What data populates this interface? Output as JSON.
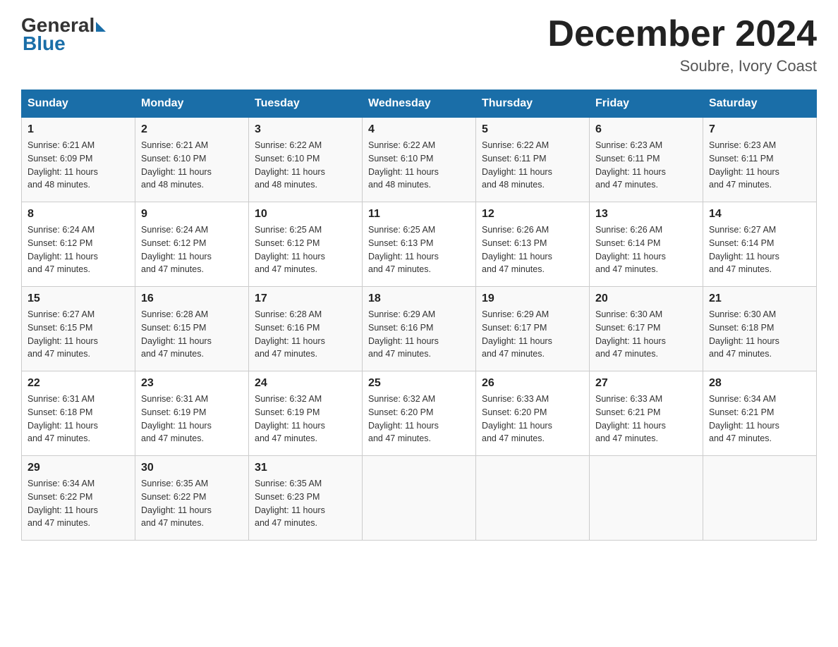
{
  "logo": {
    "general": "General",
    "blue": "Blue"
  },
  "header": {
    "month_year": "December 2024",
    "location": "Soubre, Ivory Coast"
  },
  "days_of_week": [
    "Sunday",
    "Monday",
    "Tuesday",
    "Wednesday",
    "Thursday",
    "Friday",
    "Saturday"
  ],
  "weeks": [
    [
      {
        "day": "1",
        "sunrise": "6:21 AM",
        "sunset": "6:09 PM",
        "daylight": "11 hours and 48 minutes."
      },
      {
        "day": "2",
        "sunrise": "6:21 AM",
        "sunset": "6:10 PM",
        "daylight": "11 hours and 48 minutes."
      },
      {
        "day": "3",
        "sunrise": "6:22 AM",
        "sunset": "6:10 PM",
        "daylight": "11 hours and 48 minutes."
      },
      {
        "day": "4",
        "sunrise": "6:22 AM",
        "sunset": "6:10 PM",
        "daylight": "11 hours and 48 minutes."
      },
      {
        "day": "5",
        "sunrise": "6:22 AM",
        "sunset": "6:11 PM",
        "daylight": "11 hours and 48 minutes."
      },
      {
        "day": "6",
        "sunrise": "6:23 AM",
        "sunset": "6:11 PM",
        "daylight": "11 hours and 47 minutes."
      },
      {
        "day": "7",
        "sunrise": "6:23 AM",
        "sunset": "6:11 PM",
        "daylight": "11 hours and 47 minutes."
      }
    ],
    [
      {
        "day": "8",
        "sunrise": "6:24 AM",
        "sunset": "6:12 PM",
        "daylight": "11 hours and 47 minutes."
      },
      {
        "day": "9",
        "sunrise": "6:24 AM",
        "sunset": "6:12 PM",
        "daylight": "11 hours and 47 minutes."
      },
      {
        "day": "10",
        "sunrise": "6:25 AM",
        "sunset": "6:12 PM",
        "daylight": "11 hours and 47 minutes."
      },
      {
        "day": "11",
        "sunrise": "6:25 AM",
        "sunset": "6:13 PM",
        "daylight": "11 hours and 47 minutes."
      },
      {
        "day": "12",
        "sunrise": "6:26 AM",
        "sunset": "6:13 PM",
        "daylight": "11 hours and 47 minutes."
      },
      {
        "day": "13",
        "sunrise": "6:26 AM",
        "sunset": "6:14 PM",
        "daylight": "11 hours and 47 minutes."
      },
      {
        "day": "14",
        "sunrise": "6:27 AM",
        "sunset": "6:14 PM",
        "daylight": "11 hours and 47 minutes."
      }
    ],
    [
      {
        "day": "15",
        "sunrise": "6:27 AM",
        "sunset": "6:15 PM",
        "daylight": "11 hours and 47 minutes."
      },
      {
        "day": "16",
        "sunrise": "6:28 AM",
        "sunset": "6:15 PM",
        "daylight": "11 hours and 47 minutes."
      },
      {
        "day": "17",
        "sunrise": "6:28 AM",
        "sunset": "6:16 PM",
        "daylight": "11 hours and 47 minutes."
      },
      {
        "day": "18",
        "sunrise": "6:29 AM",
        "sunset": "6:16 PM",
        "daylight": "11 hours and 47 minutes."
      },
      {
        "day": "19",
        "sunrise": "6:29 AM",
        "sunset": "6:17 PM",
        "daylight": "11 hours and 47 minutes."
      },
      {
        "day": "20",
        "sunrise": "6:30 AM",
        "sunset": "6:17 PM",
        "daylight": "11 hours and 47 minutes."
      },
      {
        "day": "21",
        "sunrise": "6:30 AM",
        "sunset": "6:18 PM",
        "daylight": "11 hours and 47 minutes."
      }
    ],
    [
      {
        "day": "22",
        "sunrise": "6:31 AM",
        "sunset": "6:18 PM",
        "daylight": "11 hours and 47 minutes."
      },
      {
        "day": "23",
        "sunrise": "6:31 AM",
        "sunset": "6:19 PM",
        "daylight": "11 hours and 47 minutes."
      },
      {
        "day": "24",
        "sunrise": "6:32 AM",
        "sunset": "6:19 PM",
        "daylight": "11 hours and 47 minutes."
      },
      {
        "day": "25",
        "sunrise": "6:32 AM",
        "sunset": "6:20 PM",
        "daylight": "11 hours and 47 minutes."
      },
      {
        "day": "26",
        "sunrise": "6:33 AM",
        "sunset": "6:20 PM",
        "daylight": "11 hours and 47 minutes."
      },
      {
        "day": "27",
        "sunrise": "6:33 AM",
        "sunset": "6:21 PM",
        "daylight": "11 hours and 47 minutes."
      },
      {
        "day": "28",
        "sunrise": "6:34 AM",
        "sunset": "6:21 PM",
        "daylight": "11 hours and 47 minutes."
      }
    ],
    [
      {
        "day": "29",
        "sunrise": "6:34 AM",
        "sunset": "6:22 PM",
        "daylight": "11 hours and 47 minutes."
      },
      {
        "day": "30",
        "sunrise": "6:35 AM",
        "sunset": "6:22 PM",
        "daylight": "11 hours and 47 minutes."
      },
      {
        "day": "31",
        "sunrise": "6:35 AM",
        "sunset": "6:23 PM",
        "daylight": "11 hours and 47 minutes."
      },
      null,
      null,
      null,
      null
    ]
  ],
  "labels": {
    "sunrise": "Sunrise:",
    "sunset": "Sunset:",
    "daylight": "Daylight:"
  }
}
